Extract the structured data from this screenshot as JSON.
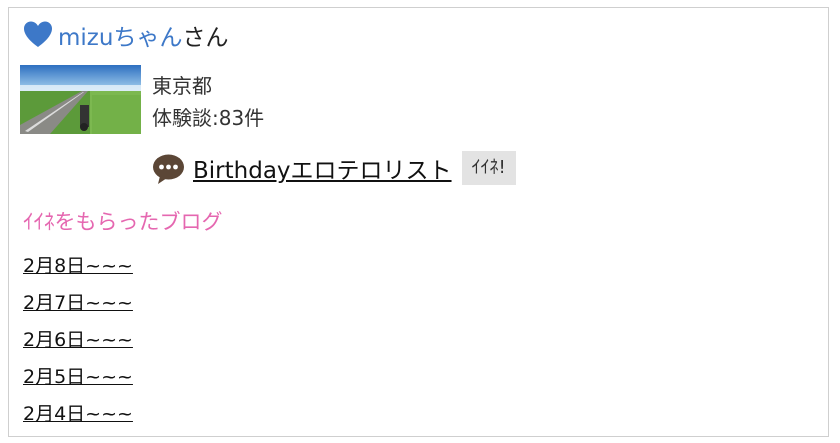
{
  "user": {
    "name": "mizuちゃん",
    "suffix": "さん"
  },
  "profile": {
    "location": "東京都",
    "reviews": "体験談:83件"
  },
  "entry": {
    "title": "Birthdayエロテロリスト",
    "like_label": "ｲｲﾈ!"
  },
  "liked_blogs": {
    "title": "ｲｲﾈをもらったブログ",
    "items": [
      "2月8日~~~",
      "2月7日~~~",
      "2月6日~~~",
      "2月5日~~~",
      "2月4日~~~"
    ]
  },
  "colors": {
    "username": "#3d78c8",
    "heart": "#3d78c8",
    "section_title": "#e567b0",
    "like_button_bg": "#e3e3e3"
  }
}
